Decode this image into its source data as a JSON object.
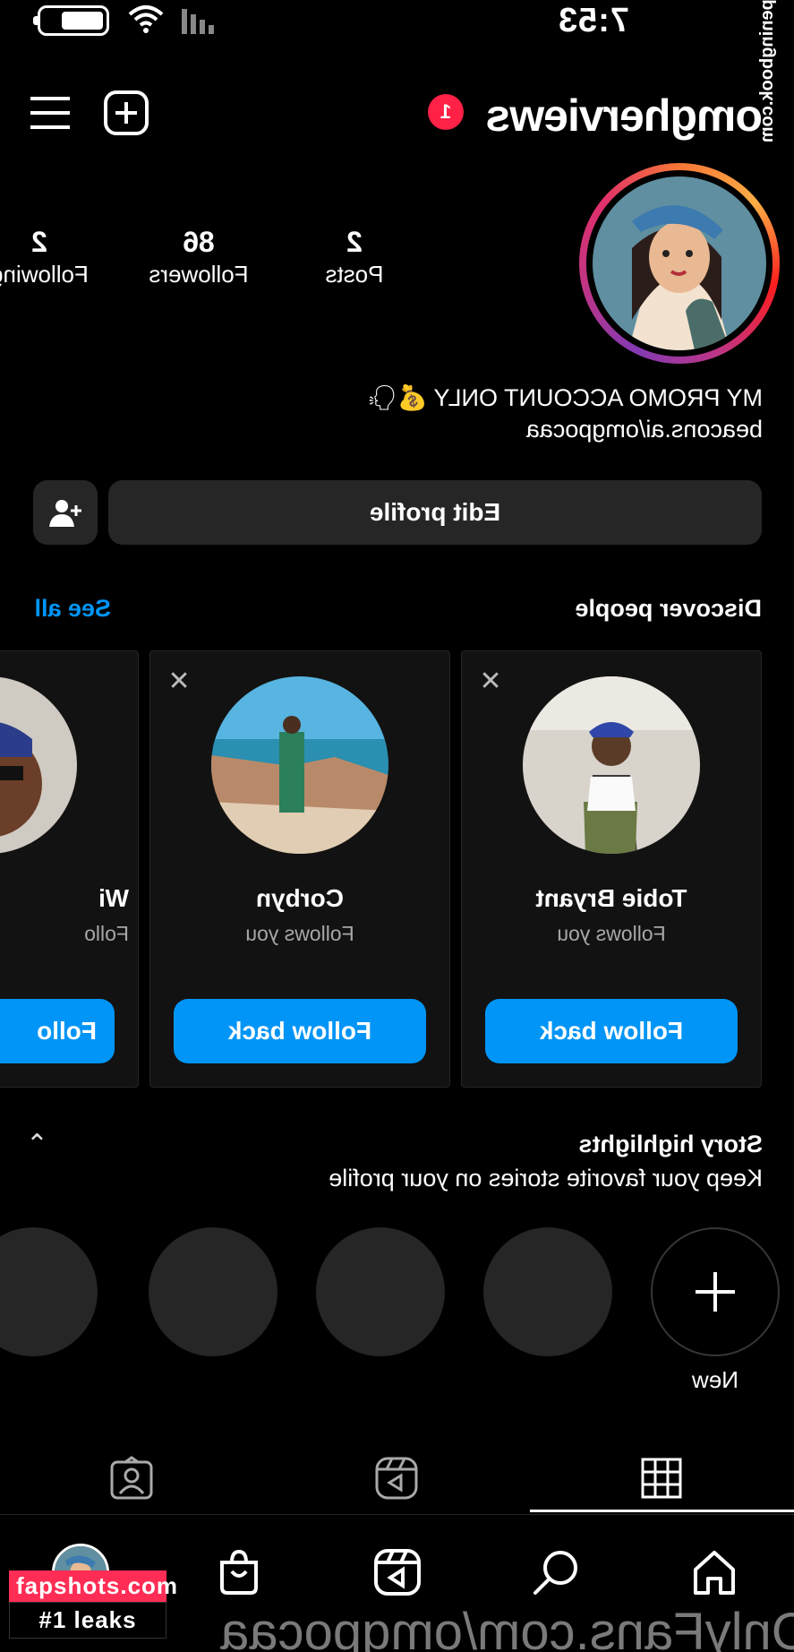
{
  "status_bar": {
    "time": "7:53"
  },
  "header": {
    "username": "omgherviews",
    "notification_count": "1"
  },
  "profile": {
    "stats": [
      {
        "count": "2",
        "label": "Posts"
      },
      {
        "count": "86",
        "label": "Followers"
      },
      {
        "count": "2",
        "label": "Following"
      }
    ],
    "bio_line": "MY PROMO ACCOUNT ONLY 💰🗣",
    "link": "beacons.ai/omgpocaa",
    "edit_label": "Edit profile"
  },
  "discover": {
    "title": "Discover people",
    "see_all": "See all",
    "cards": [
      {
        "name": "Tobie Bryant",
        "subtitle": "Follows you",
        "button": "Follow back"
      },
      {
        "name": "Corbyn",
        "subtitle": "Follows you",
        "button": "Follow back"
      },
      {
        "name": "Wi",
        "subtitle": "Follo",
        "button": "Follo"
      }
    ]
  },
  "highlights": {
    "title": "Story highlights",
    "subtitle": "Keep your favorite stories on your profile",
    "new_label": "New"
  },
  "watermarks": {
    "side": "openingbook.com",
    "bottom": "OnlyFans.com/omgpocaa",
    "badge_top": "fapshots.com",
    "badge_bottom": "#1 leaks"
  },
  "colors": {
    "accent": "#0095f6",
    "badge": "#ff2146",
    "button_bg": "#262626"
  }
}
